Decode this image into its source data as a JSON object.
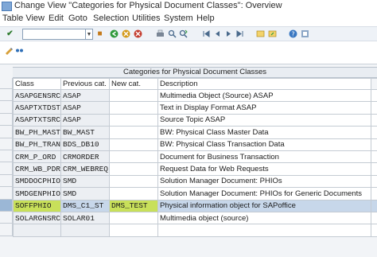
{
  "window": {
    "title": "Change View \"Categories for Physical Document Classes\": Overview"
  },
  "menu": [
    "Table View",
    "Edit",
    "Goto",
    "Selection",
    "Utilities",
    "System",
    "Help"
  ],
  "toolbar": {
    "command_field": {
      "value": "",
      "placeholder": ""
    },
    "icons": [
      "enter-icon",
      "save-icon",
      "back-icon",
      "exit-icon",
      "cancel-icon",
      "print-icon",
      "find-icon",
      "find-next-icon",
      "first-page-icon",
      "previous-page-icon",
      "next-page-icon",
      "last-page-icon",
      "new-session-icon",
      "shortcut-icon"
    ]
  },
  "app_toolbar": {
    "icons": [
      "display-change-icon",
      "other-view-icon"
    ]
  },
  "table": {
    "title": "Categories for Physical Document Classes",
    "columns": [
      "Class",
      "Previous cat.",
      "New cat.",
      "Description"
    ],
    "rows": [
      {
        "class": "ASAPGENSRC",
        "prev": "ASAP",
        "new": "",
        "desc": "Multimedia Object (Source) ASAP",
        "selected": false
      },
      {
        "class": "ASAPTXTDST",
        "prev": "ASAP",
        "new": "",
        "desc": "Text in Display Format ASAP",
        "selected": false
      },
      {
        "class": "ASAPTXTSRC",
        "prev": "ASAP",
        "new": "",
        "desc": "Source Topic ASAP",
        "selected": false
      },
      {
        "class": "BW_PH_MAST",
        "prev": "BW_MAST",
        "new": "",
        "desc": "BW: Physical Class Master Data",
        "selected": false
      },
      {
        "class": "BW_PH_TRAN",
        "prev": "BDS_DB10",
        "new": "",
        "desc": "BW: Physical Class Transaction Data",
        "selected": false
      },
      {
        "class": "CRM_P_ORD",
        "prev": "CRMORDER",
        "new": "",
        "desc": "Document for Business Transaction",
        "selected": false
      },
      {
        "class": "CRM_WB_PDR",
        "prev": "CRM_WEBREQ",
        "new": "",
        "desc": "Request Data for Web Requests",
        "selected": false
      },
      {
        "class": "SMDDOCPHIO",
        "prev": "SMD",
        "new": "",
        "desc": "Solution Manager Document: PHIOs",
        "selected": false
      },
      {
        "class": "SMDGENPHIO",
        "prev": "SMD",
        "new": "",
        "desc": "Solution Manager Document: PHIOs for Generic Documents",
        "selected": false
      },
      {
        "class": "SOFFPHIO",
        "prev": "DMS_C1_ST",
        "new": "DMS_TEST",
        "desc": "Physical information object for SAPoffice",
        "selected": true
      },
      {
        "class": "SOLARGNSRC",
        "prev": "SOLAR01",
        "new": "",
        "desc": "Multimedia object (source)",
        "selected": false
      },
      {
        "class": "",
        "prev": "",
        "new": "",
        "desc": "",
        "selected": false
      }
    ]
  },
  "colors": {
    "selected_row": "#c7d7ea",
    "highlight": "#c8e05a",
    "toolbar_bg": "#eef2f7"
  }
}
